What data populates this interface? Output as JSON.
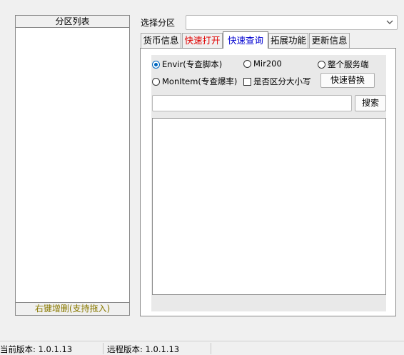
{
  "left_panel": {
    "title": "分区列表",
    "footer": "右键增删(支持拖入)"
  },
  "select_partition": {
    "label": "选择分区",
    "value": ""
  },
  "tabs": [
    {
      "label": "货币信息",
      "color": "#000000"
    },
    {
      "label": "快速打开",
      "color": "#e00000"
    },
    {
      "label": "快速查询",
      "color": "#0000d0",
      "active": true
    },
    {
      "label": "拓展功能",
      "color": "#000000"
    },
    {
      "label": "更新信息",
      "color": "#000000"
    }
  ],
  "quick_query": {
    "options": {
      "envir": "Envir(专查脚本)",
      "mir200": "Mir200",
      "whole_server": "整个服务端",
      "monitem": "MonItem(专查爆率)",
      "case_sensitive": "是否区分大小写"
    },
    "selected_option": "envir",
    "quick_replace_label": "快速替换",
    "search_value": "",
    "search_label": "搜索"
  },
  "status_bar": {
    "current_version": "当前版本: 1.0.1.13",
    "remote_version": "远程版本: 1.0.1.13"
  }
}
